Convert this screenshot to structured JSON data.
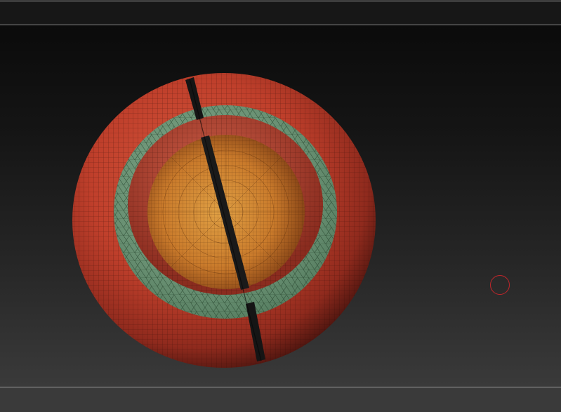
{
  "app": {
    "kind": "3D sculpting viewport",
    "top_shelf_text": "",
    "bottom_shelf_text": ""
  },
  "viewport": {
    "model": "torus-ring-with-inner-disc",
    "colors": {
      "outer_shell": "#c1412c",
      "inner_ring": "#b9452e",
      "gap_band": "#6f9a78",
      "inner_disc": "#c97c2a",
      "seam": "#151515",
      "wire": "#1a0906"
    },
    "brush_cursor_color": "#c0262b"
  }
}
